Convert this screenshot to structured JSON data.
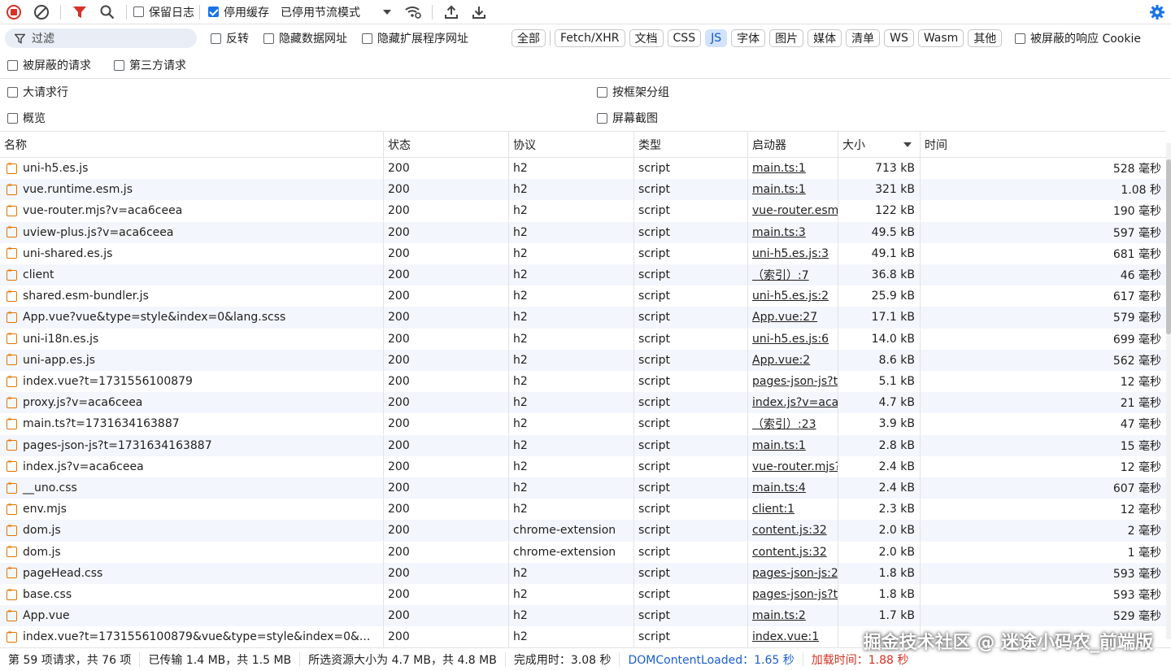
{
  "toolbar": {
    "preserve_log": "保留日志",
    "disable_cache": "停用缓存",
    "throttling": "已停用节流模式"
  },
  "filter": {
    "placeholder": "过滤",
    "invert": "反转",
    "hide_data_urls": "隐藏数据网址",
    "hide_ext_urls": "隐藏扩展程序网址",
    "types": [
      "全部",
      "Fetch/XHR",
      "文档",
      "CSS",
      "JS",
      "字体",
      "图片",
      "媒体",
      "清单",
      "WS",
      "Wasm",
      "其他"
    ],
    "active_type": "JS",
    "blocked_cookies": "被屏蔽的响应 Cookie",
    "blocked_requests": "被屏蔽的请求",
    "third_party": "第三方请求"
  },
  "options": {
    "big_rows": "大请求行",
    "group_by_frame": "按框架分组",
    "overview": "概览",
    "screenshots": "屏幕截图"
  },
  "table": {
    "headers": {
      "name": "名称",
      "status": "状态",
      "protocol": "协议",
      "type": "类型",
      "initiator": "启动器",
      "size": "大小",
      "time": "时间"
    },
    "rows": [
      {
        "name": "uni-h5.es.js",
        "status": "200",
        "protocol": "h2",
        "type": "script",
        "initiator": "main.ts:1",
        "size": "713 kB",
        "time": "528 毫秒"
      },
      {
        "name": "vue.runtime.esm.js",
        "status": "200",
        "protocol": "h2",
        "type": "script",
        "initiator": "main.ts:1",
        "size": "321 kB",
        "time": "1.08 秒"
      },
      {
        "name": "vue-router.mjs?v=aca6ceea",
        "status": "200",
        "protocol": "h2",
        "type": "script",
        "initiator": "vue-router.esm",
        "size": "122 kB",
        "time": "190 毫秒"
      },
      {
        "name": "uview-plus.js?v=aca6ceea",
        "status": "200",
        "protocol": "h2",
        "type": "script",
        "initiator": "main.ts:3",
        "size": "49.5 kB",
        "time": "597 毫秒"
      },
      {
        "name": "uni-shared.es.js",
        "status": "200",
        "protocol": "h2",
        "type": "script",
        "initiator": "uni-h5.es.js:3",
        "size": "49.1 kB",
        "time": "681 毫秒"
      },
      {
        "name": "client",
        "status": "200",
        "protocol": "h2",
        "type": "script",
        "initiator": "（索引）:7",
        "size": "36.8 kB",
        "time": "46 毫秒"
      },
      {
        "name": "shared.esm-bundler.js",
        "status": "200",
        "protocol": "h2",
        "type": "script",
        "initiator": "uni-h5.es.js:2",
        "size": "25.9 kB",
        "time": "617 毫秒"
      },
      {
        "name": "App.vue?vue&type=style&index=0&lang.scss",
        "status": "200",
        "protocol": "h2",
        "type": "script",
        "initiator": "App.vue:27",
        "size": "17.1 kB",
        "time": "579 毫秒"
      },
      {
        "name": "uni-i18n.es.js",
        "status": "200",
        "protocol": "h2",
        "type": "script",
        "initiator": "uni-h5.es.js:6",
        "size": "14.0 kB",
        "time": "699 毫秒"
      },
      {
        "name": "uni-app.es.js",
        "status": "200",
        "protocol": "h2",
        "type": "script",
        "initiator": "App.vue:2",
        "size": "8.6 kB",
        "time": "562 毫秒"
      },
      {
        "name": "index.vue?t=1731556100879",
        "status": "200",
        "protocol": "h2",
        "type": "script",
        "initiator": "pages-json-js?t",
        "size": "5.1 kB",
        "time": "12 毫秒"
      },
      {
        "name": "proxy.js?v=aca6ceea",
        "status": "200",
        "protocol": "h2",
        "type": "script",
        "initiator": "index.js?v=aca",
        "size": "4.7 kB",
        "time": "21 毫秒"
      },
      {
        "name": "main.ts?t=1731634163887",
        "status": "200",
        "protocol": "h2",
        "type": "script",
        "initiator": "（索引）:23",
        "size": "3.9 kB",
        "time": "47 毫秒"
      },
      {
        "name": "pages-json-js?t=1731634163887",
        "status": "200",
        "protocol": "h2",
        "type": "script",
        "initiator": "main.ts:1",
        "size": "2.8 kB",
        "time": "15 毫秒"
      },
      {
        "name": "index.js?v=aca6ceea",
        "status": "200",
        "protocol": "h2",
        "type": "script",
        "initiator": "vue-router.mjs?",
        "size": "2.4 kB",
        "time": "12 毫秒"
      },
      {
        "name": "__uno.css",
        "status": "200",
        "protocol": "h2",
        "type": "script",
        "initiator": "main.ts:4",
        "size": "2.4 kB",
        "time": "607 毫秒"
      },
      {
        "name": "env.mjs",
        "status": "200",
        "protocol": "h2",
        "type": "script",
        "initiator": "client:1",
        "size": "2.3 kB",
        "time": "12 毫秒"
      },
      {
        "name": "dom.js",
        "status": "200",
        "protocol": "chrome-extension",
        "type": "script",
        "initiator": "content.js:32",
        "size": "2.0 kB",
        "time": "2 毫秒"
      },
      {
        "name": "dom.js",
        "status": "200",
        "protocol": "chrome-extension",
        "type": "script",
        "initiator": "content.js:32",
        "size": "2.0 kB",
        "time": "1 毫秒"
      },
      {
        "name": "pageHead.css",
        "status": "200",
        "protocol": "h2",
        "type": "script",
        "initiator": "pages-json-js:2",
        "size": "1.8 kB",
        "time": "593 毫秒"
      },
      {
        "name": "base.css",
        "status": "200",
        "protocol": "h2",
        "type": "script",
        "initiator": "pages-json-js?t",
        "size": "1.8 kB",
        "time": "593 毫秒"
      },
      {
        "name": "App.vue",
        "status": "200",
        "protocol": "h2",
        "type": "script",
        "initiator": "main.ts:2",
        "size": "1.7 kB",
        "time": "529 毫秒"
      },
      {
        "name": "index.vue?t=1731556100879&vue&type=style&index=0&...",
        "status": "200",
        "protocol": "h2",
        "type": "script",
        "initiator": "index.vue:1",
        "size": "",
        "time": ""
      }
    ]
  },
  "status": {
    "requests": "第 59 项请求，共 76 项",
    "transferred": "已传输 1.4 MB，共 1.5 MB",
    "resources": "所选资源大小为 4.7 MB，共 4.8 MB",
    "finish": "完成用时：3.08 秒",
    "dcl": "DOMContentLoaded：1.65 秒",
    "load": "加载时间：1.88 秒"
  },
  "watermark": "掘金技术社区 @ 迷途小码农_前端版",
  "colors": {
    "accent": "#1a73e8",
    "record_red": "#d93025",
    "dcl_blue": "#1a5fd0",
    "load_red": "#d93025",
    "file_icon": "#e37400"
  }
}
